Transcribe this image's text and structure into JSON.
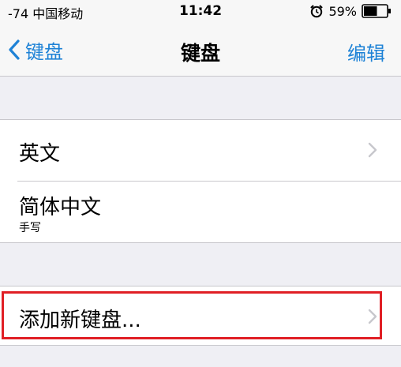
{
  "status_bar": {
    "carrier": "-74 中国移动",
    "time": "11:42",
    "battery": "59%",
    "battery_level": 0.59,
    "alarm_icon": "alarm-clock-icon",
    "battery_icon": "battery-icon"
  },
  "nav": {
    "back_label": "键盘",
    "back_icon": "chevron-left-icon",
    "title": "键盘",
    "edit_label": "编辑"
  },
  "keyboards": [
    {
      "label": "英文",
      "sublabel": "",
      "has_chevron": true
    },
    {
      "label": "简体中文",
      "sublabel": "手写",
      "has_chevron": false
    }
  ],
  "add_keyboard": {
    "label": "添加新键盘...",
    "has_chevron": true
  },
  "colors": {
    "accent": "#1e82d6",
    "highlight": "#e01f25",
    "background": "#efeff4"
  }
}
